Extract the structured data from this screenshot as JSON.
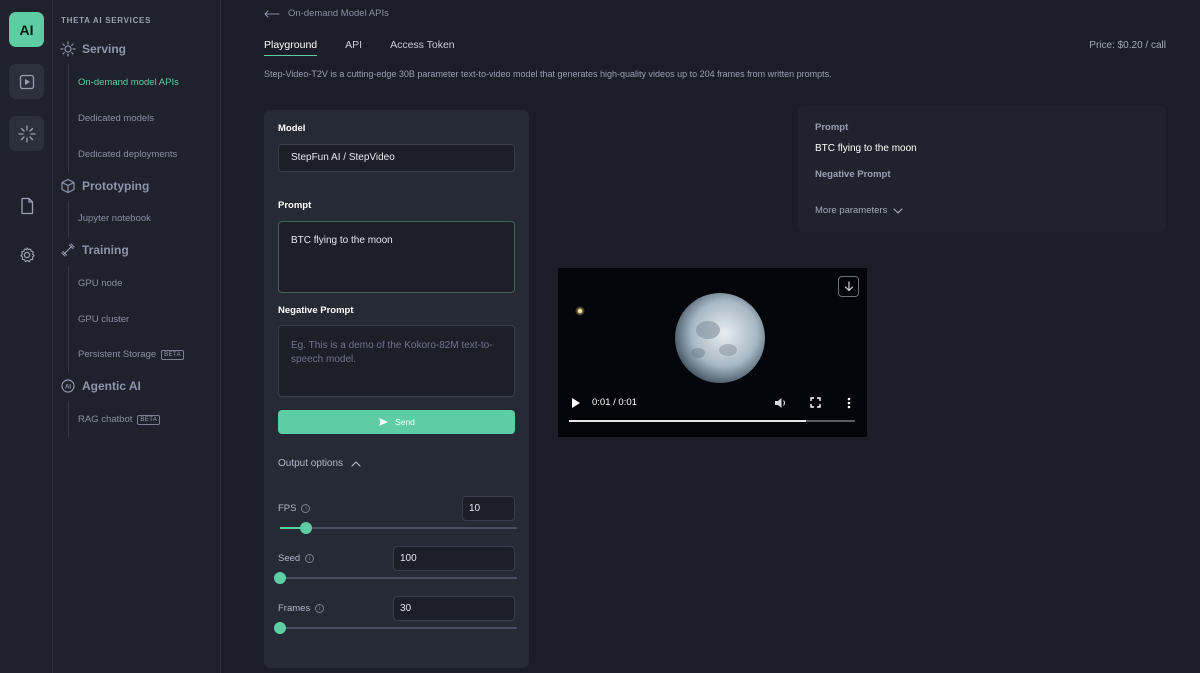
{
  "rail": {
    "ai_label": "AI"
  },
  "sidebar": {
    "title": "THETA AI SERVICES",
    "serving": {
      "label": "Serving",
      "items": [
        "On-demand model APIs",
        "Dedicated models",
        "Dedicated deployments"
      ]
    },
    "prototyping": {
      "label": "Prototyping",
      "items": [
        "Jupyter notebook"
      ]
    },
    "training": {
      "label": "Training",
      "items": [
        "GPU node",
        "GPU cluster",
        "Persistent Storage"
      ],
      "storage_badge": "BETA"
    },
    "agentic": {
      "label": "Agentic AI",
      "items": [
        "RAG chatbot"
      ],
      "rag_badge": "BETA"
    }
  },
  "header": {
    "back_label": "On-demand Model APIs",
    "tabs": [
      "Playground",
      "API",
      "Access Token"
    ],
    "active_tab": "Playground",
    "price": "Price: $0.20 / call",
    "description": "Step-Video-T2V is a cutting-edge 30B parameter text-to-video model that generates high-quality videos up to 204 frames from written prompts."
  },
  "form": {
    "model_label": "Model",
    "model_value": "StepFun AI / StepVideo",
    "prompt_label": "Prompt",
    "prompt_value": "BTC flying to the moon",
    "negative_label": "Negative Prompt",
    "negative_placeholder": "Eg. This is a demo of the Kokoro-82M text-to-speech model.",
    "send_label": "Send",
    "output_options_label": "Output options",
    "params": [
      {
        "label": "FPS",
        "value": "10",
        "slider_fraction": 0.11
      },
      {
        "label": "Seed",
        "value": "100",
        "slider_fraction": 0.0
      },
      {
        "label": "Frames",
        "value": "30",
        "slider_fraction": 0.0
      }
    ]
  },
  "summary": {
    "prompt_label": "Prompt",
    "prompt_value": "BTC flying to the moon",
    "negative_label": "Negative Prompt",
    "more_label": "More parameters"
  },
  "video": {
    "time": "0:01 / 0:01",
    "progress_fraction": 0.83
  },
  "colors": {
    "accent": "#5fcda4",
    "background": "#1b1e28",
    "panel": "#262a35"
  }
}
